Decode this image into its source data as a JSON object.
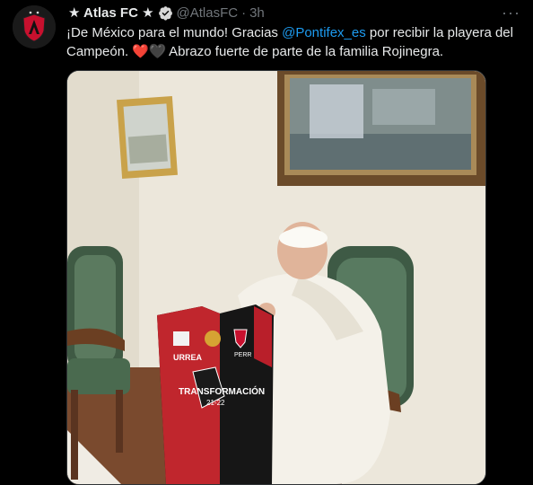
{
  "tweet": {
    "display_name": "★ Atlas FC ★",
    "handle": "@AtlasFC",
    "separator": "·",
    "time": "3h",
    "text_part1": "¡De México para el mundo! Gracias ",
    "mention": "@Pontifex_es",
    "text_part2": " por recibir la playera del Campeón. ",
    "heart_red": "❤️",
    "heart_black": "🖤",
    "text_part3": " Abrazo fuerte de parte de la familia Rojinegra.",
    "more_icon": "···"
  },
  "media": {
    "jersey_sponsor": "URREA",
    "jersey_text": "TRANSFORMACIÓN",
    "jersey_years": "21-22",
    "jersey_brand": "PERR"
  },
  "colors": {
    "background": "#000000",
    "text": "#e7e9ea",
    "secondary": "#71767b",
    "link": "#1d9bf0",
    "verified": "#1d9bf0"
  }
}
